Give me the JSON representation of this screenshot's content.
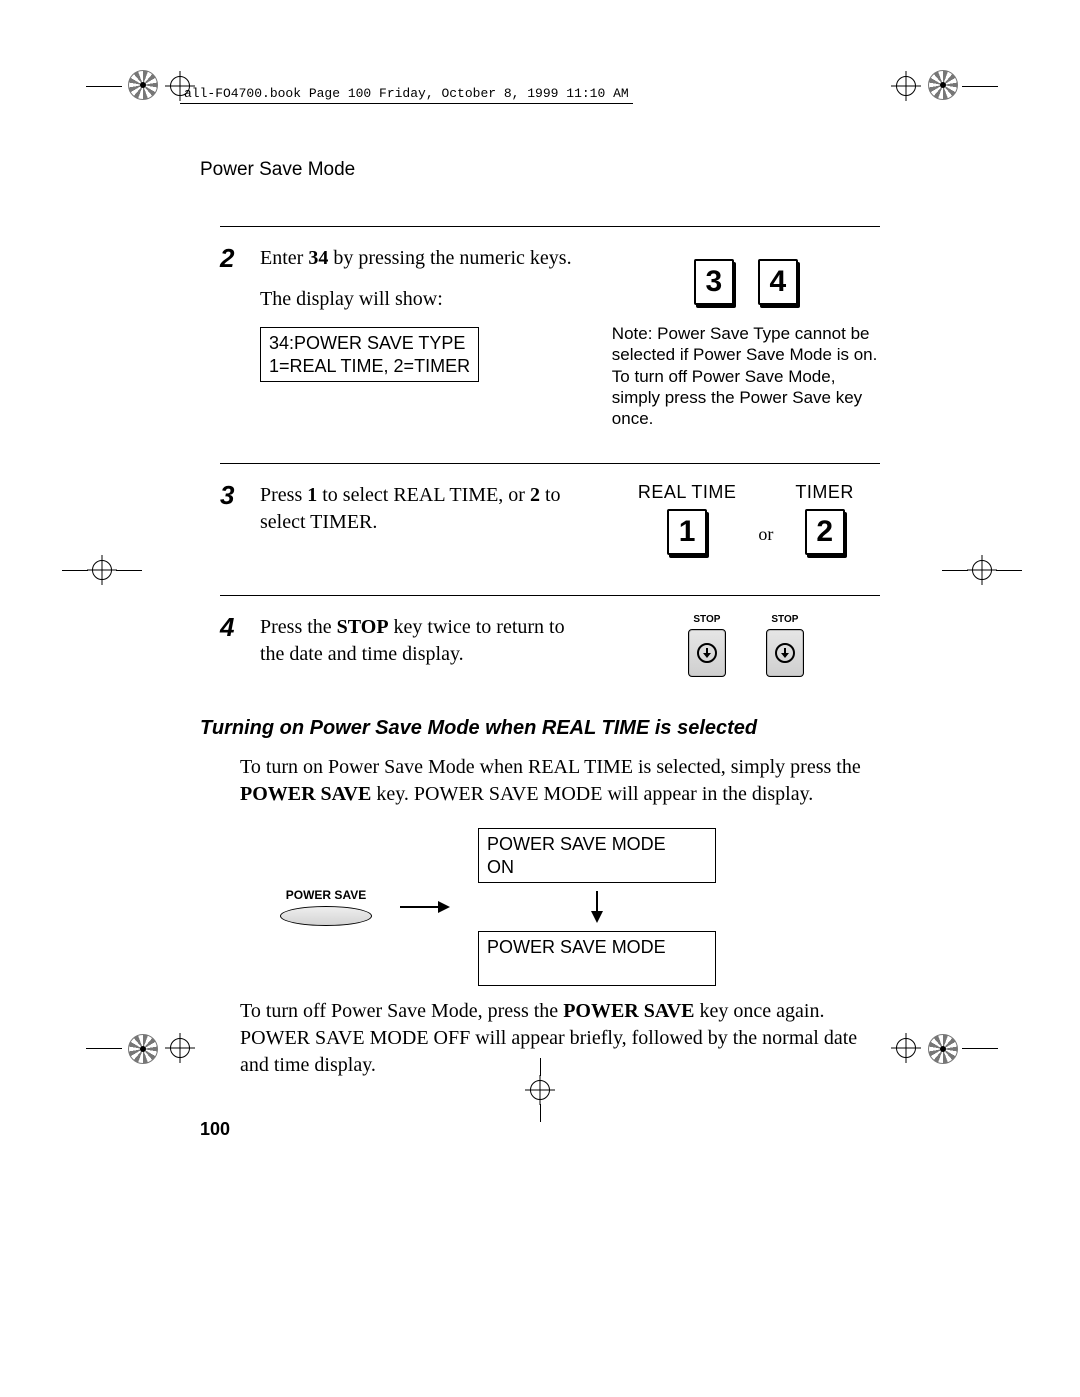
{
  "meta": {
    "book_info": "all-FO4700.book  Page 100  Friday, October 8, 1999  11:10 AM"
  },
  "header": {
    "section_title": "Power Save Mode"
  },
  "page_number": "100",
  "step2": {
    "num": "2",
    "text_a": "Enter ",
    "text_b_bold": "34",
    "text_c": " by pressing the numeric keys.",
    "text_d": "The display will show:",
    "display_line1": "34:POWER SAVE TYPE",
    "display_line2": "1=REAL TIME, 2=TIMER",
    "key_a": "3",
    "key_b": "4",
    "note": "Note: Power Save Type cannot be selected if Power Save Mode is on. To turn off Power Save Mode, simply press the Power Save key once."
  },
  "step3": {
    "num": "3",
    "text_a": "Press ",
    "b1": "1",
    "text_b": " to select REAL TIME, or ",
    "b2": "2",
    "text_c": " to select TIMER.",
    "label_rt": "REAL TIME",
    "label_tm": "TIMER",
    "key_1": "1",
    "or": "or",
    "key_2": "2"
  },
  "step4": {
    "num": "4",
    "text_a": "Press the ",
    "bold": "STOP",
    "text_b": " key twice to return to the date and time display.",
    "stop_label": "STOP"
  },
  "sub": {
    "heading": "Turning on Power Save Mode when REAL TIME is selected",
    "para1_a": "To turn on Power Save Mode when REAL TIME is selected, simply press the ",
    "para1_bold": "POWER SAVE",
    "para1_b": " key. POWER SAVE MODE will appear in the display.",
    "ps_label": "POWER SAVE",
    "box1_l1": "POWER SAVE MODE",
    "box1_l2": "ON",
    "box2_l1": "POWER SAVE MODE",
    "para2_a": "To turn off Power Save Mode, press the ",
    "para2_bold": "POWER SAVE",
    "para2_b": " key once again. POWER SAVE MODE OFF will appear briefly, followed by the normal date and time display."
  }
}
